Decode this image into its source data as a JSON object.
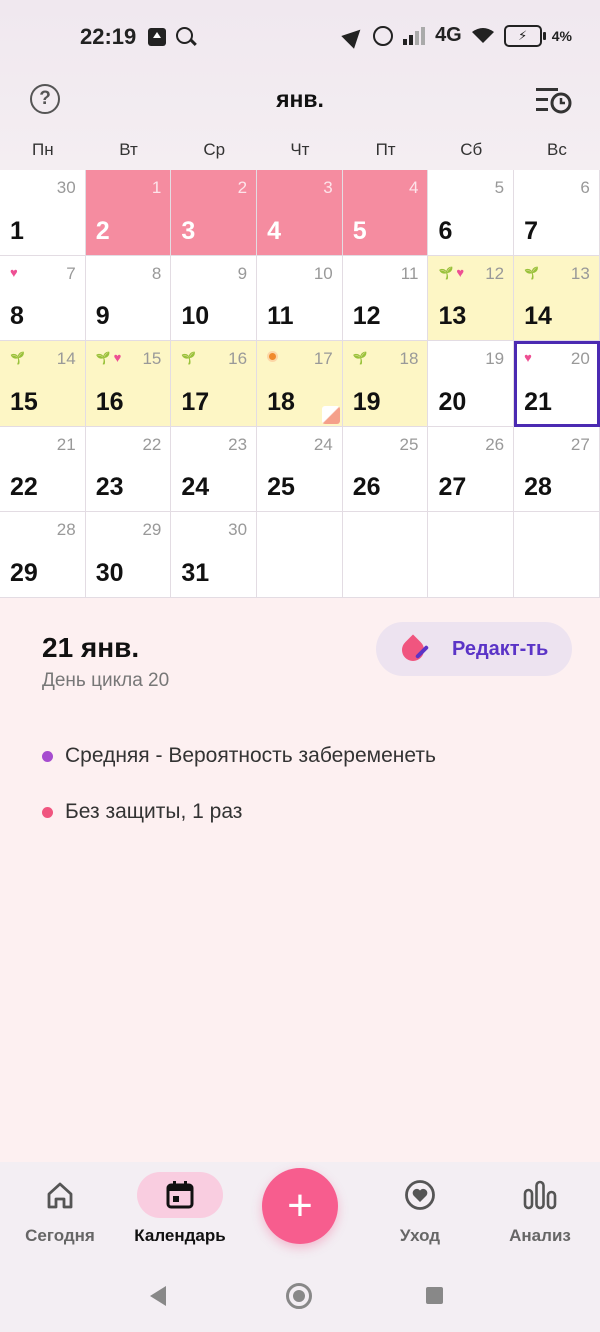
{
  "status_bar": {
    "time": "22:19",
    "network": "4G",
    "battery": "4",
    "battery_unit": "%"
  },
  "header": {
    "month": "янв."
  },
  "weekdays": [
    "Пн",
    "Вт",
    "Ср",
    "Чт",
    "Пт",
    "Сб",
    "Вс"
  ],
  "calendar": {
    "rows": [
      [
        {
          "day": "1",
          "cycle": "30",
          "type": "plain"
        },
        {
          "day": "2",
          "cycle": "1",
          "type": "period"
        },
        {
          "day": "3",
          "cycle": "2",
          "type": "period"
        },
        {
          "day": "4",
          "cycle": "3",
          "type": "period"
        },
        {
          "day": "5",
          "cycle": "4",
          "type": "period"
        },
        {
          "day": "6",
          "cycle": "5",
          "type": "plain"
        },
        {
          "day": "7",
          "cycle": "6",
          "type": "plain"
        }
      ],
      [
        {
          "day": "8",
          "cycle": "7",
          "type": "plain",
          "heart": true
        },
        {
          "day": "9",
          "cycle": "8",
          "type": "plain"
        },
        {
          "day": "10",
          "cycle": "9",
          "type": "plain"
        },
        {
          "day": "11",
          "cycle": "10",
          "type": "plain"
        },
        {
          "day": "12",
          "cycle": "11",
          "type": "plain"
        },
        {
          "day": "13",
          "cycle": "12",
          "type": "fertile",
          "sprout": true,
          "heart": true
        },
        {
          "day": "14",
          "cycle": "13",
          "type": "fertile",
          "sprout": true
        }
      ],
      [
        {
          "day": "15",
          "cycle": "14",
          "type": "fertile",
          "sprout": true
        },
        {
          "day": "16",
          "cycle": "15",
          "type": "fertile",
          "sprout": true,
          "heart": true
        },
        {
          "day": "17",
          "cycle": "16",
          "type": "fertile",
          "sprout": true
        },
        {
          "day": "18",
          "cycle": "17",
          "type": "fertile",
          "ovulation": true,
          "note": true
        },
        {
          "day": "19",
          "cycle": "18",
          "type": "fertile",
          "sprout": true
        },
        {
          "day": "20",
          "cycle": "19",
          "type": "plain"
        },
        {
          "day": "21",
          "cycle": "20",
          "type": "plain",
          "heart": true,
          "today": true
        }
      ],
      [
        {
          "day": "22",
          "cycle": "21",
          "type": "plain"
        },
        {
          "day": "23",
          "cycle": "22",
          "type": "plain"
        },
        {
          "day": "24",
          "cycle": "23",
          "type": "plain"
        },
        {
          "day": "25",
          "cycle": "24",
          "type": "plain"
        },
        {
          "day": "26",
          "cycle": "25",
          "type": "plain"
        },
        {
          "day": "27",
          "cycle": "26",
          "type": "plain"
        },
        {
          "day": "28",
          "cycle": "27",
          "type": "plain"
        }
      ],
      [
        {
          "day": "29",
          "cycle": "28",
          "type": "plain"
        },
        {
          "day": "30",
          "cycle": "29",
          "type": "plain"
        },
        {
          "day": "31",
          "cycle": "30",
          "type": "plain"
        },
        {
          "day": "",
          "cycle": "",
          "type": "empty"
        },
        {
          "day": "",
          "cycle": "",
          "type": "empty"
        },
        {
          "day": "",
          "cycle": "",
          "type": "empty"
        },
        {
          "day": "",
          "cycle": "",
          "type": "empty"
        }
      ]
    ]
  },
  "detail": {
    "date": "21 янв.",
    "cycle_day": "День цикла 20",
    "edit_label": "Редакт-ть",
    "events": [
      {
        "text": "Средняя - Вероятность забеременеть",
        "color": "#a64ccf"
      },
      {
        "text": "Без защиты, 1 раз",
        "color": "#f0557f"
      }
    ]
  },
  "bottom_nav": [
    {
      "label": "Сегодня",
      "icon": "home-icon"
    },
    {
      "label": "Календарь",
      "icon": "calendar-icon",
      "active": true
    },
    {
      "label": "Уход",
      "icon": "heart-circle-icon"
    },
    {
      "label": "Анализ",
      "icon": "bar-chart-icon"
    }
  ],
  "fab": {
    "label": "+"
  },
  "colors": {
    "period": "#f58ca0",
    "fertile": "#fdf6c5",
    "accent": "#5b34c7",
    "fab": "#f75d8e"
  }
}
